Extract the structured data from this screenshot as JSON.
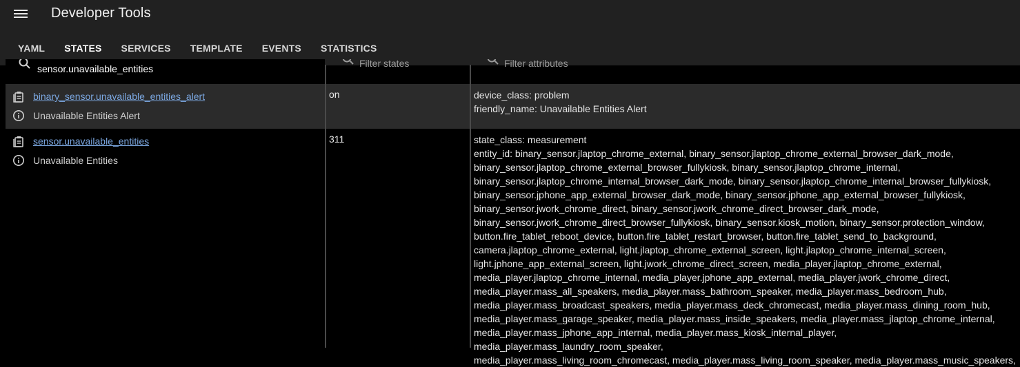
{
  "header": {
    "title": "Developer Tools"
  },
  "tabs": [
    {
      "label": "YAML",
      "active": false
    },
    {
      "label": "STATES",
      "active": true
    },
    {
      "label": "SERVICES",
      "active": false
    },
    {
      "label": "TEMPLATE",
      "active": false
    },
    {
      "label": "EVENTS",
      "active": false
    },
    {
      "label": "STATISTICS",
      "active": false
    }
  ],
  "filters": {
    "entity_value": "sensor.unavailable_entities",
    "states_placeholder": "Filter states",
    "attributes_placeholder": "Filter attributes"
  },
  "rows": [
    {
      "entity_id": "binary_sensor.unavailable_entities_alert",
      "friendly_name": "Unavailable Entities Alert",
      "state": "on",
      "attributes": [
        "device_class: problem",
        "friendly_name: Unavailable Entities Alert"
      ]
    },
    {
      "entity_id": "sensor.unavailable_entities",
      "friendly_name": "Unavailable Entities",
      "state": "311",
      "attributes": [
        "state_class: measurement",
        "entity_id: binary_sensor.jlaptop_chrome_external, binary_sensor.jlaptop_chrome_external_browser_dark_mode,",
        "binary_sensor.jlaptop_chrome_external_browser_fullykiosk, binary_sensor.jlaptop_chrome_internal,",
        "binary_sensor.jlaptop_chrome_internal_browser_dark_mode, binary_sensor.jlaptop_chrome_internal_browser_fullykiosk,",
        "binary_sensor.jphone_app_external_browser_dark_mode, binary_sensor.jphone_app_external_browser_fullykiosk,",
        "binary_sensor.jwork_chrome_direct, binary_sensor.jwork_chrome_direct_browser_dark_mode,",
        "binary_sensor.jwork_chrome_direct_browser_fullykiosk, binary_sensor.kiosk_motion, binary_sensor.protection_window,",
        "button.fire_tablet_reboot_device, button.fire_tablet_restart_browser, button.fire_tablet_send_to_background,",
        "camera.jlaptop_chrome_external, light.jlaptop_chrome_external_screen, light.jlaptop_chrome_internal_screen,",
        "light.jphone_app_external_screen, light.jwork_chrome_direct_screen, media_player.jlaptop_chrome_external,",
        "media_player.jlaptop_chrome_internal, media_player.jphone_app_external, media_player.jwork_chrome_direct,",
        "media_player.mass_all_speakers, media_player.mass_bathroom_speaker, media_player.mass_bedroom_hub,",
        "media_player.mass_broadcast_speakers, media_player.mass_deck_chromecast, media_player.mass_dining_room_hub,",
        "media_player.mass_garage_speaker, media_player.mass_inside_speakers, media_player.mass_jlaptop_chrome_internal,",
        "media_player.mass_jphone_app_internal, media_player.mass_kiosk_internal_player, media_player.mass_laundry_room_speaker,",
        "media_player.mass_living_room_chromecast, media_player.mass_living_room_speaker, media_player.mass_music_speakers,"
      ]
    }
  ],
  "colors": {
    "header_bg": "#212121",
    "link": "#7ba7e0",
    "highlight_row": "#2b2b2b",
    "filter_underline": "#7ba3d6"
  }
}
